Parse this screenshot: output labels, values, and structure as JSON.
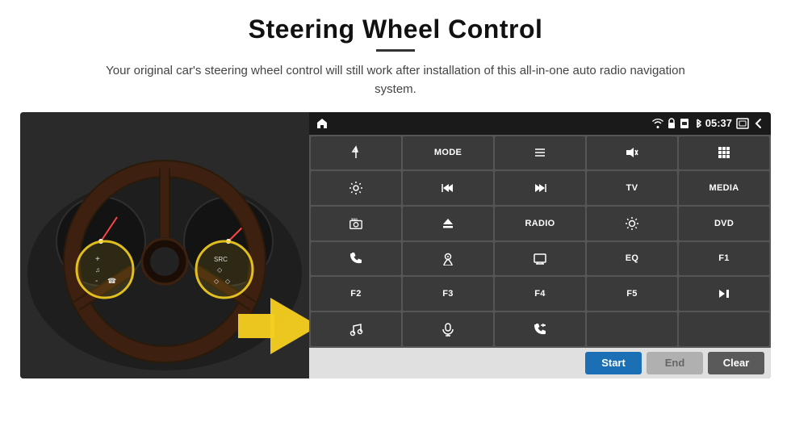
{
  "page": {
    "title": "Steering Wheel Control",
    "subtitle": "Your original car's steering wheel control will still work after installation of this all-in-one auto radio navigation system.",
    "divider": true
  },
  "status_bar": {
    "time": "05:37",
    "icons": [
      "wifi",
      "lock",
      "sim",
      "bluetooth",
      "screenshot",
      "back"
    ]
  },
  "control_buttons": [
    {
      "id": "nav",
      "icon": "nav",
      "label": ""
    },
    {
      "id": "mode",
      "icon": "",
      "label": "MODE"
    },
    {
      "id": "list",
      "icon": "list",
      "label": ""
    },
    {
      "id": "mute",
      "icon": "mute",
      "label": ""
    },
    {
      "id": "apps",
      "icon": "apps",
      "label": ""
    },
    {
      "id": "settings",
      "icon": "settings",
      "label": ""
    },
    {
      "id": "prev",
      "icon": "prev",
      "label": ""
    },
    {
      "id": "next",
      "icon": "next",
      "label": ""
    },
    {
      "id": "tv",
      "icon": "",
      "label": "TV"
    },
    {
      "id": "media",
      "icon": "",
      "label": "MEDIA"
    },
    {
      "id": "cam360",
      "icon": "360cam",
      "label": ""
    },
    {
      "id": "eject",
      "icon": "eject",
      "label": ""
    },
    {
      "id": "radio",
      "icon": "",
      "label": "RADIO"
    },
    {
      "id": "brightness",
      "icon": "brightness",
      "label": ""
    },
    {
      "id": "dvd",
      "icon": "",
      "label": "DVD"
    },
    {
      "id": "phone",
      "icon": "phone",
      "label": ""
    },
    {
      "id": "nav2",
      "icon": "nav2",
      "label": ""
    },
    {
      "id": "screen",
      "icon": "screen",
      "label": ""
    },
    {
      "id": "eq",
      "icon": "",
      "label": "EQ"
    },
    {
      "id": "f1",
      "icon": "",
      "label": "F1"
    },
    {
      "id": "f2",
      "icon": "",
      "label": "F2"
    },
    {
      "id": "f3",
      "icon": "",
      "label": "F3"
    },
    {
      "id": "f4",
      "icon": "",
      "label": "F4"
    },
    {
      "id": "f5",
      "icon": "",
      "label": "F5"
    },
    {
      "id": "playpause",
      "icon": "playpause",
      "label": ""
    },
    {
      "id": "music",
      "icon": "music",
      "label": ""
    },
    {
      "id": "mic",
      "icon": "mic",
      "label": ""
    },
    {
      "id": "phoneanswer",
      "icon": "phoneanswer",
      "label": ""
    },
    {
      "id": "empty1",
      "icon": "",
      "label": ""
    },
    {
      "id": "empty2",
      "icon": "",
      "label": ""
    }
  ],
  "bottom_buttons": {
    "start": "Start",
    "end": "End",
    "clear": "Clear"
  }
}
